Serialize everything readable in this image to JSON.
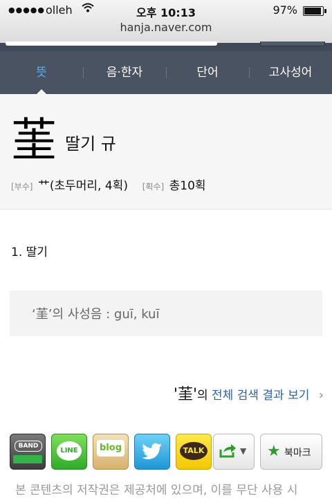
{
  "status_bar": {
    "signal": "●●●●●",
    "carrier": "olleh",
    "wifi_icon": "wifi-icon",
    "time": "오후 10:13",
    "battery_pct": "97%",
    "battery_level": 0.97,
    "url": "hanja.naver.com"
  },
  "nav": {
    "tabs": [
      {
        "label": "뜻",
        "active": true
      },
      {
        "label": "음·한자",
        "active": false
      },
      {
        "label": "단어",
        "active": false
      },
      {
        "label": "고사성어",
        "active": false
      }
    ],
    "active_color": "#58b4ff",
    "background": "#4a5362"
  },
  "character": {
    "glyph": "茥",
    "meaning": "딸기 규",
    "radical_tag": "[부수]",
    "radical": "艹(초두머리, 4획)",
    "strokes_tag": "[획수]",
    "strokes": "총10획"
  },
  "definition": {
    "item": "1. 딸기"
  },
  "reading": {
    "text": "‘茥’의 사성음 :  guī, kuī"
  },
  "search_link": {
    "quoted_char": "'茥'",
    "particle": "의",
    "link_text": "전체 검색 결과 보기",
    "chevron": "›",
    "link_color": "#2a62b0"
  },
  "share": {
    "band_label": "BAND",
    "line_label": "LINE",
    "blog_label": "blog",
    "twitter_icon": "twitter-bird-icon",
    "talk_label": "TALK",
    "bookmark_label": "북마크"
  },
  "footer": {
    "copyright": "본 콘텐츠의 저작권은 제공처에 있으며, 이를 무단 사용 시"
  }
}
